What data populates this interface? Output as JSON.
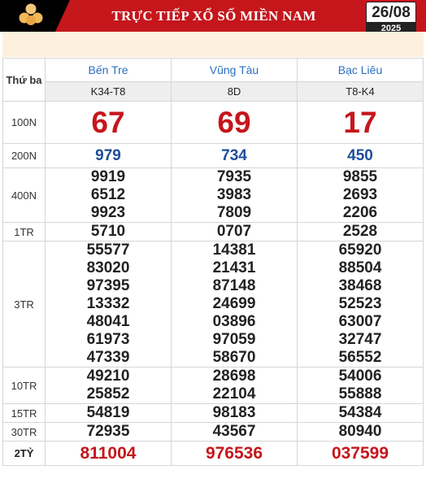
{
  "header": {
    "title": "TRỰC TIẾP XỔ SỐ MIỀN NAM",
    "date": "26/08",
    "year": "2025",
    "accent_color": "#c5161c",
    "logo_icon": "lottery-balls-icon"
  },
  "table": {
    "day_label": "Thứ ba",
    "provinces": [
      {
        "name": "Bến Tre",
        "code": "K34-T8"
      },
      {
        "name": "Vũng Tàu",
        "code": "8D"
      },
      {
        "name": "Bạc Liêu",
        "code": "T8-K4"
      }
    ],
    "prizes": [
      {
        "label": "100N",
        "values": [
          [
            "67"
          ],
          [
            "69"
          ],
          [
            "17"
          ]
        ]
      },
      {
        "label": "200N",
        "values": [
          [
            "979"
          ],
          [
            "734"
          ],
          [
            "450"
          ]
        ]
      },
      {
        "label": "400N",
        "values": [
          [
            "9919",
            "6512",
            "9923"
          ],
          [
            "7935",
            "3983",
            "7809"
          ],
          [
            "9855",
            "2693",
            "2206"
          ]
        ]
      },
      {
        "label": "1TR",
        "values": [
          [
            "5710"
          ],
          [
            "0707"
          ],
          [
            "2528"
          ]
        ]
      },
      {
        "label": "3TR",
        "values": [
          [
            "55577",
            "83020",
            "97395",
            "13332",
            "48041",
            "61973",
            "47339"
          ],
          [
            "14381",
            "21431",
            "87148",
            "24699",
            "03896",
            "97059",
            "58670"
          ],
          [
            "65920",
            "88504",
            "38468",
            "52523",
            "63007",
            "32747",
            "56552"
          ]
        ]
      },
      {
        "label": "10TR",
        "values": [
          [
            "49210",
            "25852"
          ],
          [
            "28698",
            "22104"
          ],
          [
            "54006",
            "55888"
          ]
        ]
      },
      {
        "label": "15TR",
        "values": [
          [
            "54819"
          ],
          [
            "98183"
          ],
          [
            "54384"
          ]
        ]
      },
      {
        "label": "30TR",
        "values": [
          [
            "72935"
          ],
          [
            "43567"
          ],
          [
            "80940"
          ]
        ]
      },
      {
        "label": "2TỶ",
        "values": [
          [
            "811004"
          ],
          [
            "976536"
          ],
          [
            "037599"
          ]
        ]
      }
    ]
  }
}
